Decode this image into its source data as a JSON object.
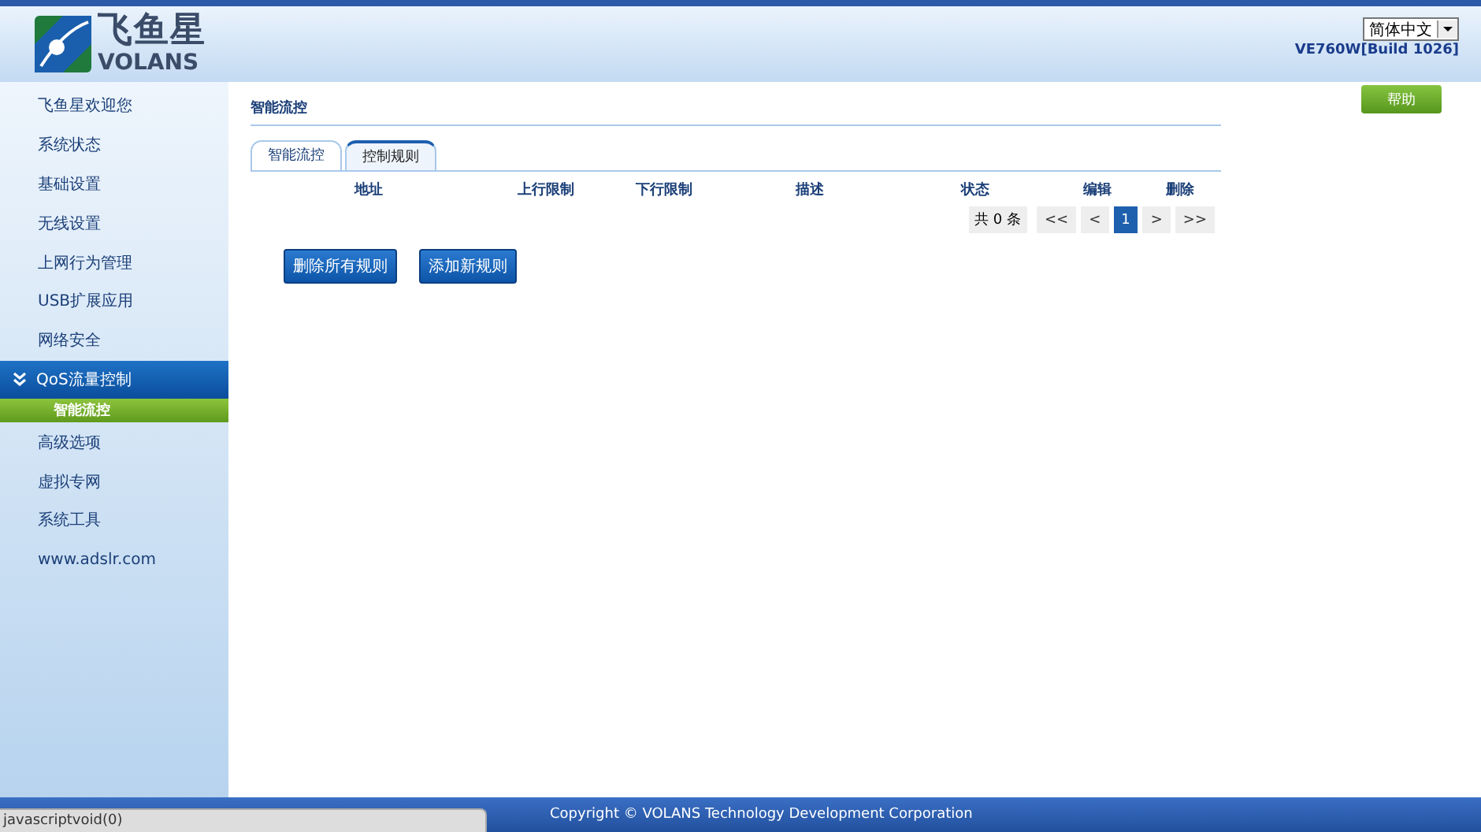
{
  "header": {
    "logo_cn": "飞鱼星",
    "logo_en": "VOLANS",
    "language": "简体中文",
    "version": "VE760W[Build 1026]"
  },
  "sidebar": {
    "items": [
      {
        "label": "飞鱼星欢迎您",
        "selected": false,
        "expanded": false
      },
      {
        "label": "系统状态",
        "selected": false,
        "expanded": false
      },
      {
        "label": "基础设置",
        "selected": false,
        "expanded": false
      },
      {
        "label": "无线设置",
        "selected": false,
        "expanded": false
      },
      {
        "label": "上网行为管理",
        "selected": false,
        "expanded": false
      },
      {
        "label": "USB扩展应用",
        "selected": false,
        "expanded": false
      },
      {
        "label": "网络安全",
        "selected": false,
        "expanded": false
      },
      {
        "label": "QoS流量控制",
        "selected": true,
        "expanded": true,
        "children": [
          {
            "label": "智能流控",
            "selected": true
          }
        ]
      },
      {
        "label": "高级选项",
        "selected": false,
        "expanded": false
      },
      {
        "label": "虚拟专网",
        "selected": false,
        "expanded": false
      },
      {
        "label": "系统工具",
        "selected": false,
        "expanded": false
      },
      {
        "label": "www.adslr.com",
        "selected": false,
        "expanded": false
      }
    ]
  },
  "page": {
    "title": "智能流控",
    "help": "帮助",
    "tabs": [
      {
        "label": "智能流控",
        "selected": false
      },
      {
        "label": "控制规则",
        "selected": true
      }
    ],
    "table": {
      "columns": [
        "地址",
        "上行限制",
        "下行限制",
        "描述",
        "状态",
        "编辑",
        "删除"
      ]
    },
    "pager": {
      "total": "共 0 条",
      "first": "<<",
      "prev": "<",
      "pages": [
        {
          "label": "1",
          "selected": true
        }
      ],
      "next": ">",
      "last": ">>"
    },
    "buttons": [
      "删除所有规则",
      "添加新规则"
    ]
  },
  "footer": {
    "copyright": "Copyright © VOLANS Technology Development Corporation"
  },
  "status_bar": {
    "text": "javascriptvoid(0)"
  }
}
